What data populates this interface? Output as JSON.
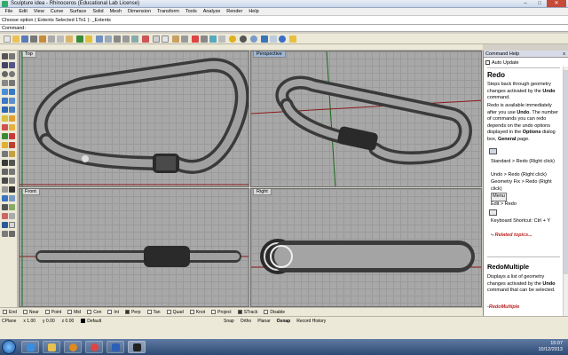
{
  "window": {
    "title": "Sculpture idea - Rhinoceros (Educational Lab License)",
    "controls": {
      "minimize": "–",
      "maximize": "□",
      "close": "✕"
    }
  },
  "menu": [
    "File",
    "Edit",
    "View",
    "Curve",
    "Surface",
    "Solid",
    "Mesh",
    "Dimension",
    "Transform",
    "Tools",
    "Analyze",
    "Render",
    "Help"
  ],
  "command_history": "Choose option ( Extents  Selected  1To1 ): _Extents",
  "command_prompt": "Command:",
  "viewports": {
    "top": "Top",
    "perspective": "Perspective",
    "front": "Front",
    "right": "Right"
  },
  "command_help": {
    "panel_title": "Command Help",
    "close": "x",
    "auto_update": "Auto Update",
    "title": "Redo",
    "description_parts": [
      "Steps back through geometry changes activated by the ",
      "Undo",
      " command."
    ],
    "body_parts": [
      "Redo is available immediately after you use ",
      "Undo",
      ". The number of commands you can redo depends on the undo options displayed in the ",
      "Options",
      " dialog box, ",
      "General",
      " page."
    ],
    "entries": [
      "Standard > Redo (Right click)",
      "Undo > Redo (Right click)",
      "Geometry Fix > Redo (Right click)",
      "Menu",
      "Edit > Redo",
      "Keyboard Shortcut: Ctrl + Y"
    ],
    "related": "Related topics...",
    "section2_title": "RedoMultiple",
    "section2_parts": [
      "Displays a list of geometry changes activated by the ",
      "Undo",
      " command that can be selected."
    ],
    "section2_link": "RedoMultiple"
  },
  "osnaps": [
    {
      "label": "End",
      "on": false
    },
    {
      "label": "Near",
      "on": false
    },
    {
      "label": "Point",
      "on": false
    },
    {
      "label": "Mid",
      "on": false
    },
    {
      "label": "Cen",
      "on": false
    },
    {
      "label": "Int",
      "on": false
    },
    {
      "label": "Perp",
      "on": true
    },
    {
      "label": "Tan",
      "on": false
    },
    {
      "label": "Quad",
      "on": false
    },
    {
      "label": "Knot",
      "on": false
    },
    {
      "label": "Project",
      "on": false
    },
    {
      "label": "STrack",
      "on": true
    },
    {
      "label": "Disable",
      "on": false
    }
  ],
  "status": {
    "cplane": "CPlane",
    "x": "x 1.00",
    "y": "y 0.00",
    "z": "z 0.00",
    "layer": "Default",
    "panes": [
      "Snap",
      "Ortho",
      "Planar",
      "Osnap",
      "Record History"
    ]
  },
  "taskbar": {
    "time": "15:07",
    "date": "10/12/2013"
  },
  "colors": {
    "accent": "#9fb7d6",
    "viewport_bg": "#a8a8a8",
    "link": "#b22222"
  }
}
